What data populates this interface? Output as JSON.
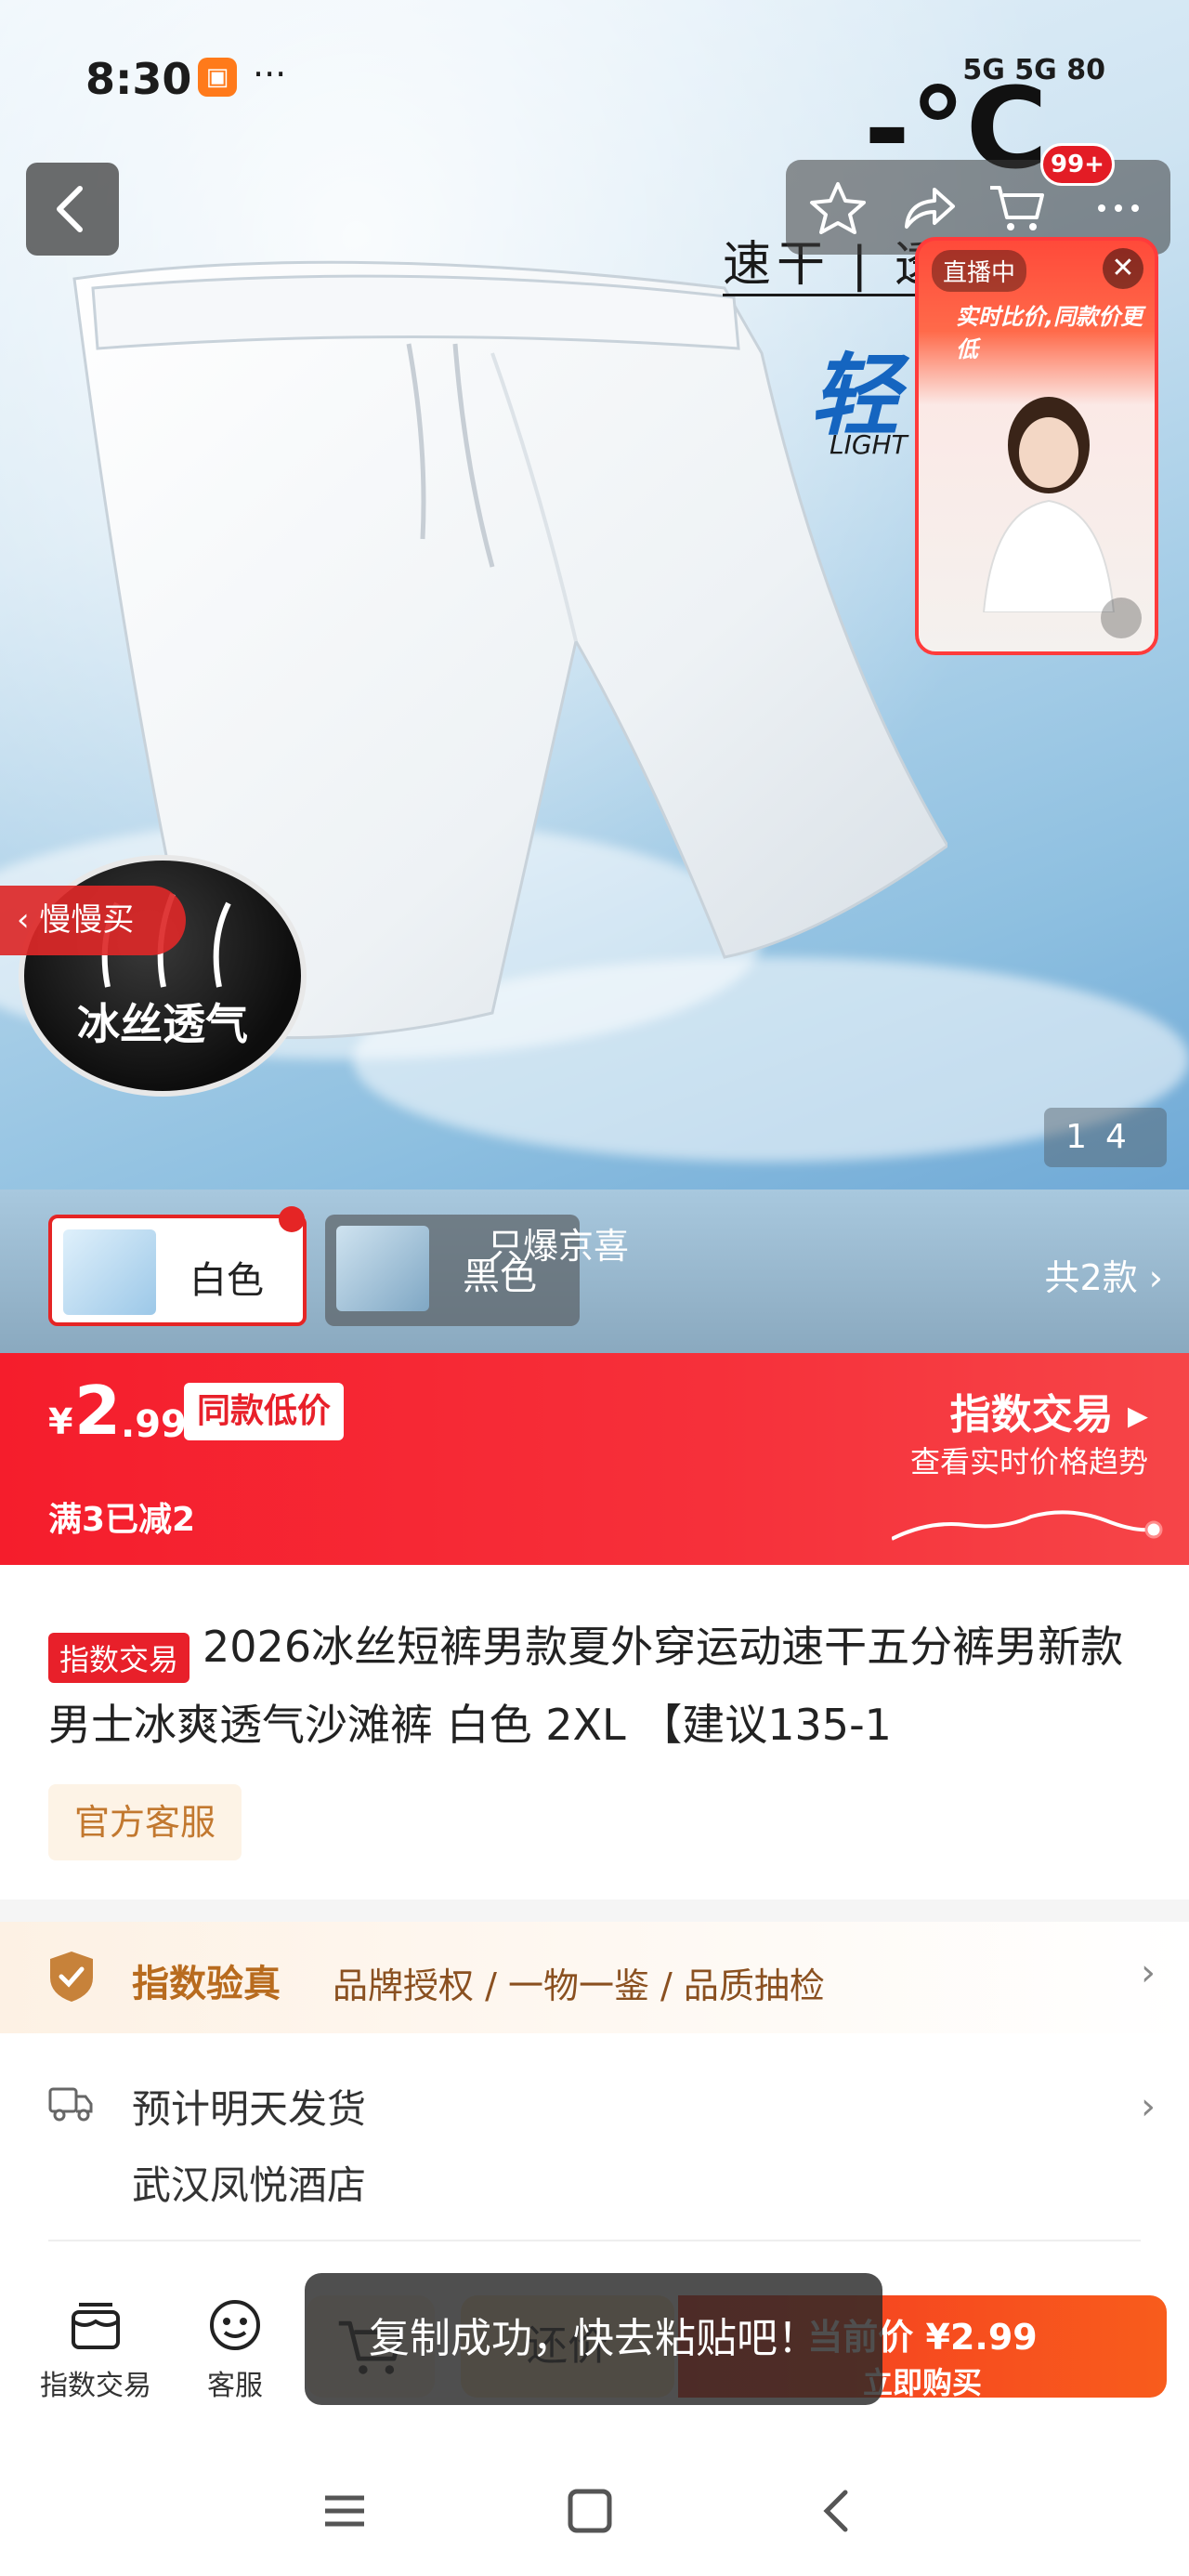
{
  "status_bar": {
    "time": "8:30",
    "app_badge_icon": "shopping-bag-icon",
    "dots": "···",
    "network": "5G 5G 80"
  },
  "top_actions": {
    "cart_badge": "99+",
    "icons": [
      "back-icon",
      "star-icon",
      "share-icon",
      "cart-icon",
      "more-icon"
    ]
  },
  "hero": {
    "caption": "速干 | 透",
    "big_text": "轻",
    "light_text": "LIGHT",
    "temp_text": "-°C",
    "slow_buy": "慢慢买",
    "badge": "冰丝透气",
    "pager_current": "1",
    "pager_total": "4"
  },
  "live": {
    "tag": "直播中",
    "slogan": "实时比价,同款价更低"
  },
  "variants": {
    "items": [
      {
        "label": "白色",
        "selected": true
      },
      {
        "label": "黑色",
        "selected": false
      }
    ],
    "flash_text": "只爆京喜",
    "count": "共2款"
  },
  "price": {
    "currency": "¥",
    "integer": "2",
    "decimal": ".99",
    "same_low": "同款低价",
    "promo": "满3已减2",
    "index_title": "指数交易",
    "index_sub": "查看实时价格趋势"
  },
  "product": {
    "tag": "指数交易",
    "title": "2026冰丝短裤男款夏外穿运动速干五分裤男新款男士冰爽透气沙滩裤 白色 2XL 【建议135-1",
    "service_tag": "官方客服"
  },
  "verify": {
    "title": "指数验真",
    "items": "品牌授权 / 一物一鉴 / 品质抽检"
  },
  "shipping": {
    "line1": "预计明天发货",
    "line2": "武汉凤悦酒店"
  },
  "actions": {
    "index_trade": "指数交易",
    "service": "客服",
    "bargain": "还价",
    "buy_price": "当前价 ¥2.99",
    "buy_label": "立即购买"
  },
  "toast": "复制成功，快去粘贴吧！",
  "colors": {
    "brand_red": "#f51d2c",
    "verify_gold": "#b86b1e",
    "buy_orange": "#f85c1c"
  }
}
